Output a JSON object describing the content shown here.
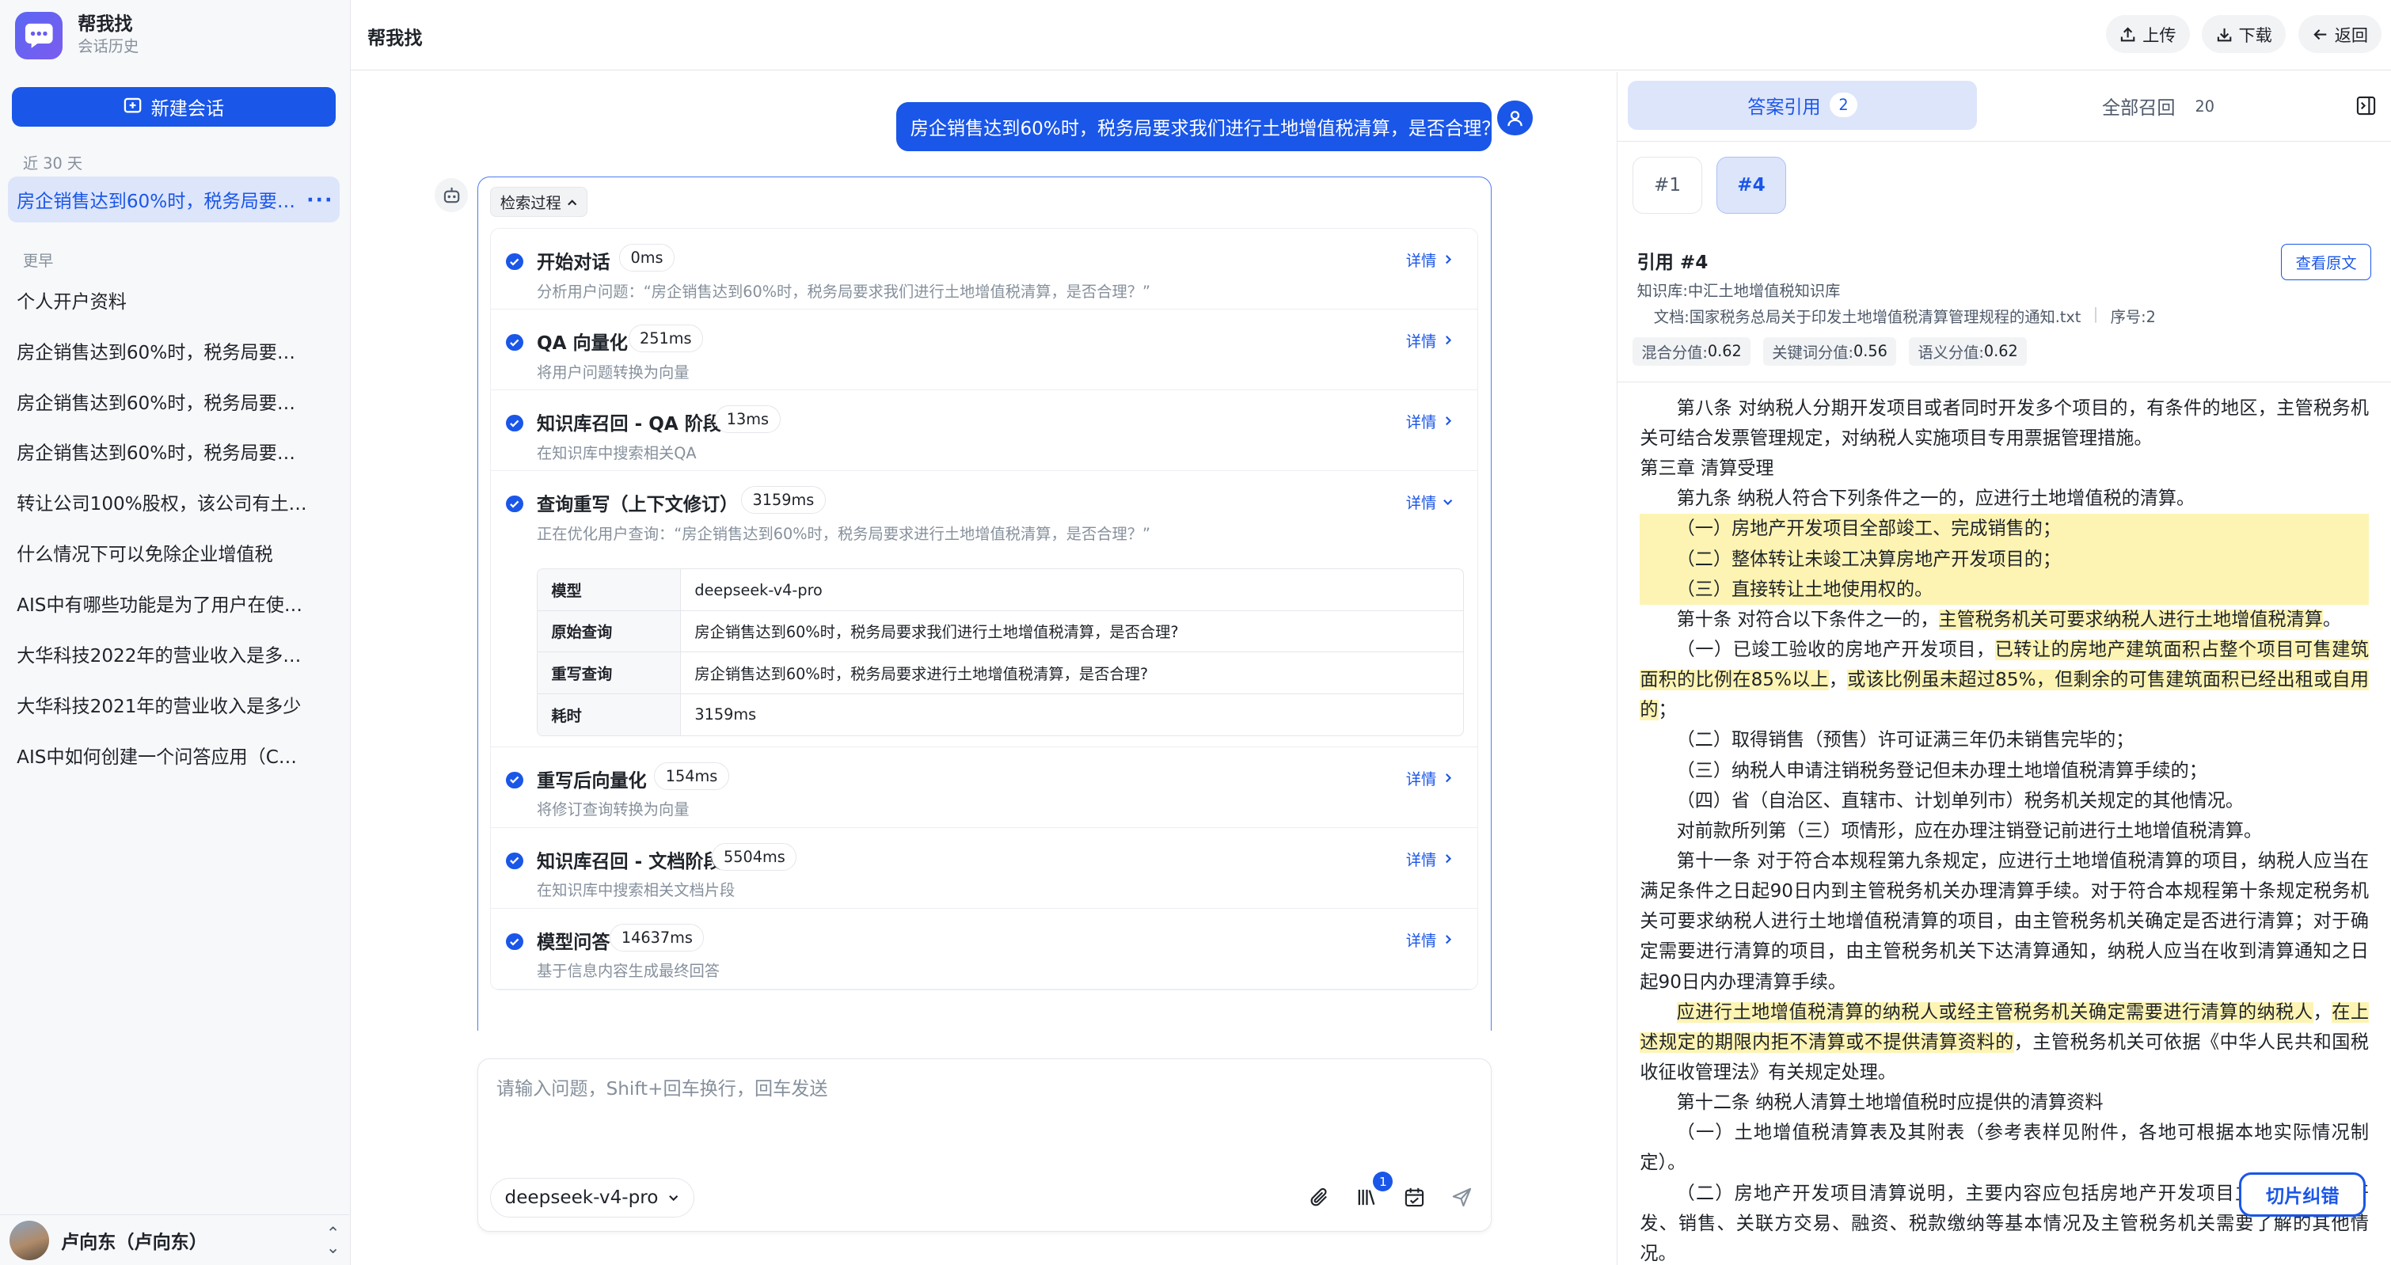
{
  "app": {
    "name": "帮我找",
    "subtitle": "会话历史"
  },
  "sidebar": {
    "new_chat_label": "新建会话",
    "section_recent": "近 30 天",
    "active_item": "房企销售达到60%时，税务局要求我们进行土地增值税清算，是否合理？",
    "active_item_display": "房企销售达到60%时，税务局要…",
    "section_earlier": "更早",
    "items": [
      {
        "label": "个人开户资料"
      },
      {
        "label": "房企销售达到60%时，税务局要…"
      },
      {
        "label": "房企销售达到60%时，税务局要…"
      },
      {
        "label": "房企销售达到60%时，税务局要…"
      },
      {
        "label": "转让公司100%股权，该公司有土…"
      },
      {
        "label": "什么情况下可以免除企业增值税"
      },
      {
        "label": "AIS中有哪些功能是为了用户在使…"
      },
      {
        "label": "大华科技2022年的营业收入是多…"
      },
      {
        "label": "大华科技2021年的营业收入是多少"
      },
      {
        "label": "AIS中如何创建一个问答应用（C…"
      }
    ],
    "user_name": "卢向东（卢向东）"
  },
  "header": {
    "title": "帮我找",
    "upload": "上传",
    "download": "下载",
    "back": "返回"
  },
  "chat": {
    "user_message": "房企销售达到60%时，税务局要求我们进行土地增值税清算，是否合理？",
    "process_label": "检索过程",
    "detail_label": "详情",
    "steps": [
      {
        "title": "开始对话",
        "duration": "0ms",
        "desc": "分析用户问题：“房企销售达到60%时，税务局要求我们进行土地增值税清算，是否合理？”"
      },
      {
        "title": "QA 向量化",
        "duration": "251ms",
        "desc": "将用户问题转换为向量"
      },
      {
        "title": "知识库召回 - QA 阶段",
        "duration": "13ms",
        "desc": "在知识库中搜索相关QA"
      },
      {
        "title": "查询重写（上下文修订）",
        "duration": "3159ms",
        "desc": "正在优化用户查询：“房企销售达到60%时，税务局要求进行土地增值税清算，是否合理？”"
      },
      {
        "title": "重写后向量化",
        "duration": "154ms",
        "desc": "将修订查询转换为向量"
      },
      {
        "title": "知识库召回 - 文档阶段",
        "duration": "5504ms",
        "desc": "在知识库中搜索相关文档片段"
      },
      {
        "title": "模型问答",
        "duration": "14637ms",
        "desc": "基于信息内容生成最终回答"
      }
    ],
    "rewrite_table": [
      {
        "key": "模型",
        "value": "deepseek-v4-pro"
      },
      {
        "key": "原始查询",
        "value": "房企销售达到60%时，税务局要求我们进行土地增值税清算，是否合理?"
      },
      {
        "key": "重写查询",
        "value": "房企销售达到60%时，税务局要求进行土地增值税清算，是否合理?"
      },
      {
        "key": "耗时",
        "value": "3159ms"
      }
    ],
    "composer": {
      "placeholder": "请输入问题，Shift+回车换行，回车发送",
      "model": "deepseek-v4-pro",
      "kb_badge": "1"
    }
  },
  "right_panel": {
    "tab_cite": "答案引用",
    "tab_cite_count": "2",
    "tab_all": "全部召回",
    "tab_all_count": "20",
    "chips": [
      "#1",
      "#4"
    ],
    "ref_title": "引用 #4",
    "view_original": "查看原文",
    "kb": "知识库:中汇土地增值税知识库",
    "doc": "文档:国家税务总局关于印发土地增值税清算管理规程的通知.txt",
    "seq": "序号:2",
    "scores": {
      "mix_label": "混合分值:",
      "mix": "0.62",
      "kw_label": "关键词分值:",
      "kw": "0.56",
      "sem_label": "语义分值:",
      "sem": "0.62"
    },
    "fix_button": "切片纠错"
  },
  "colors": {
    "accent": "#1a56e8",
    "highlight": "#fdf4b3"
  }
}
